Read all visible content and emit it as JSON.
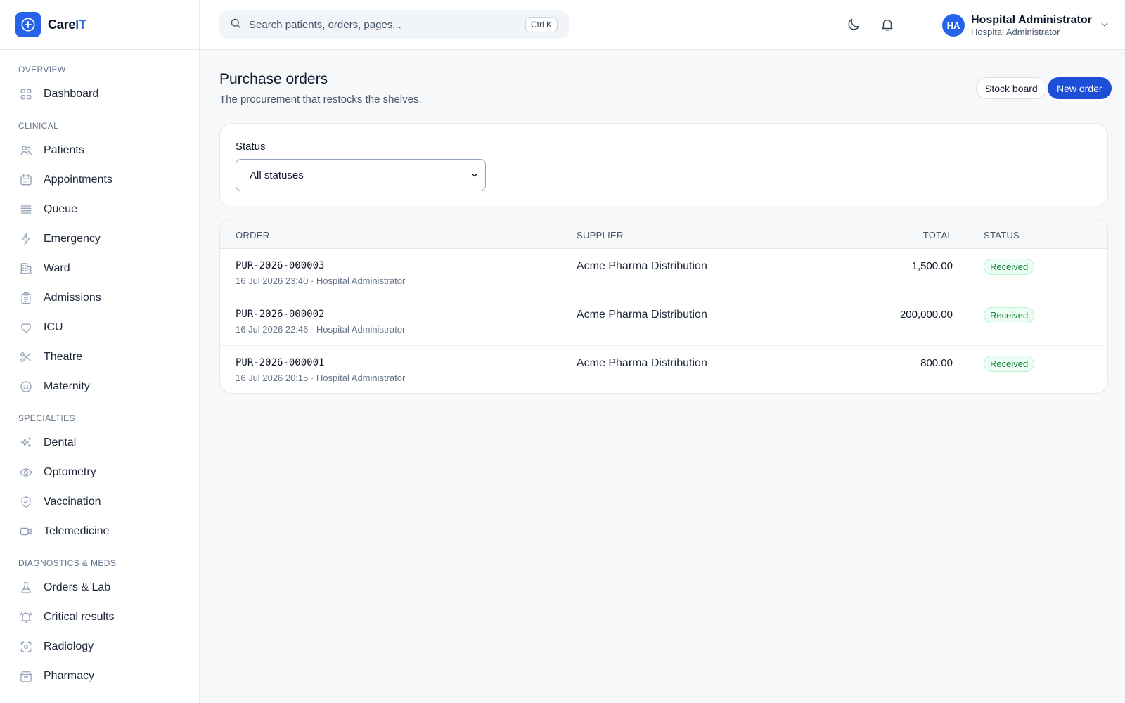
{
  "brand": {
    "name_prefix": "Care",
    "name_accent": "IT"
  },
  "sidebar": {
    "sections": [
      {
        "heading": "OVERVIEW",
        "items": [
          {
            "label": "Dashboard",
            "icon": "grid-icon"
          }
        ]
      },
      {
        "heading": "CLINICAL",
        "items": [
          {
            "label": "Patients",
            "icon": "users-icon"
          },
          {
            "label": "Appointments",
            "icon": "calendar-icon"
          },
          {
            "label": "Queue",
            "icon": "list-icon"
          },
          {
            "label": "Emergency",
            "icon": "lightning-icon"
          },
          {
            "label": "Ward",
            "icon": "building-icon"
          },
          {
            "label": "Admissions",
            "icon": "clipboard-icon"
          },
          {
            "label": "ICU",
            "icon": "heart-icon"
          },
          {
            "label": "Theatre",
            "icon": "scissors-icon"
          },
          {
            "label": "Maternity",
            "icon": "smile-icon"
          }
        ]
      },
      {
        "heading": "SPECIALTIES",
        "items": [
          {
            "label": "Dental",
            "icon": "sparkles-icon"
          },
          {
            "label": "Optometry",
            "icon": "eye-icon"
          },
          {
            "label": "Vaccination",
            "icon": "shield-check-icon"
          },
          {
            "label": "Telemedicine",
            "icon": "video-icon"
          }
        ]
      },
      {
        "heading": "DIAGNOSTICS & MEDS",
        "items": [
          {
            "label": "Orders & Lab",
            "icon": "flask-icon"
          },
          {
            "label": "Critical results",
            "icon": "bell-alert-icon"
          },
          {
            "label": "Radiology",
            "icon": "scan-icon"
          },
          {
            "label": "Pharmacy",
            "icon": "pharmacy-box-icon"
          }
        ]
      }
    ]
  },
  "topbar": {
    "search_placeholder": "Search patients, orders, pages...",
    "search_shortcut": "Ctrl K",
    "user": {
      "initials": "HA",
      "name": "Hospital Administrator",
      "role": "Hospital Administrator"
    }
  },
  "page": {
    "title": "Purchase orders",
    "subtitle": "The procurement that restocks the shelves.",
    "actions": {
      "stock_board": "Stock board",
      "new_order": "New order"
    }
  },
  "filter": {
    "label": "Status",
    "selected": "All statuses"
  },
  "table": {
    "columns": {
      "order": "ORDER",
      "supplier": "SUPPLIER",
      "total": "TOTAL",
      "status": "STATUS"
    },
    "rows": [
      {
        "order": "PUR-2026-000003",
        "meta": "16 Jul 2026 23:40 · Hospital Administrator",
        "supplier": "Acme Pharma Distribution",
        "total": "1,500.00",
        "status": "Received"
      },
      {
        "order": "PUR-2026-000002",
        "meta": "16 Jul 2026 22:46 · Hospital Administrator",
        "supplier": "Acme Pharma Distribution",
        "total": "200,000.00",
        "status": "Received"
      },
      {
        "order": "PUR-2026-000001",
        "meta": "16 Jul 2026 20:15 · Hospital Administrator",
        "supplier": "Acme Pharma Distribution",
        "total": "800.00",
        "status": "Received"
      }
    ]
  },
  "colors": {
    "accent": "#2563eb",
    "primary_button": "#1d4ed8",
    "status_received": "#15803d"
  }
}
